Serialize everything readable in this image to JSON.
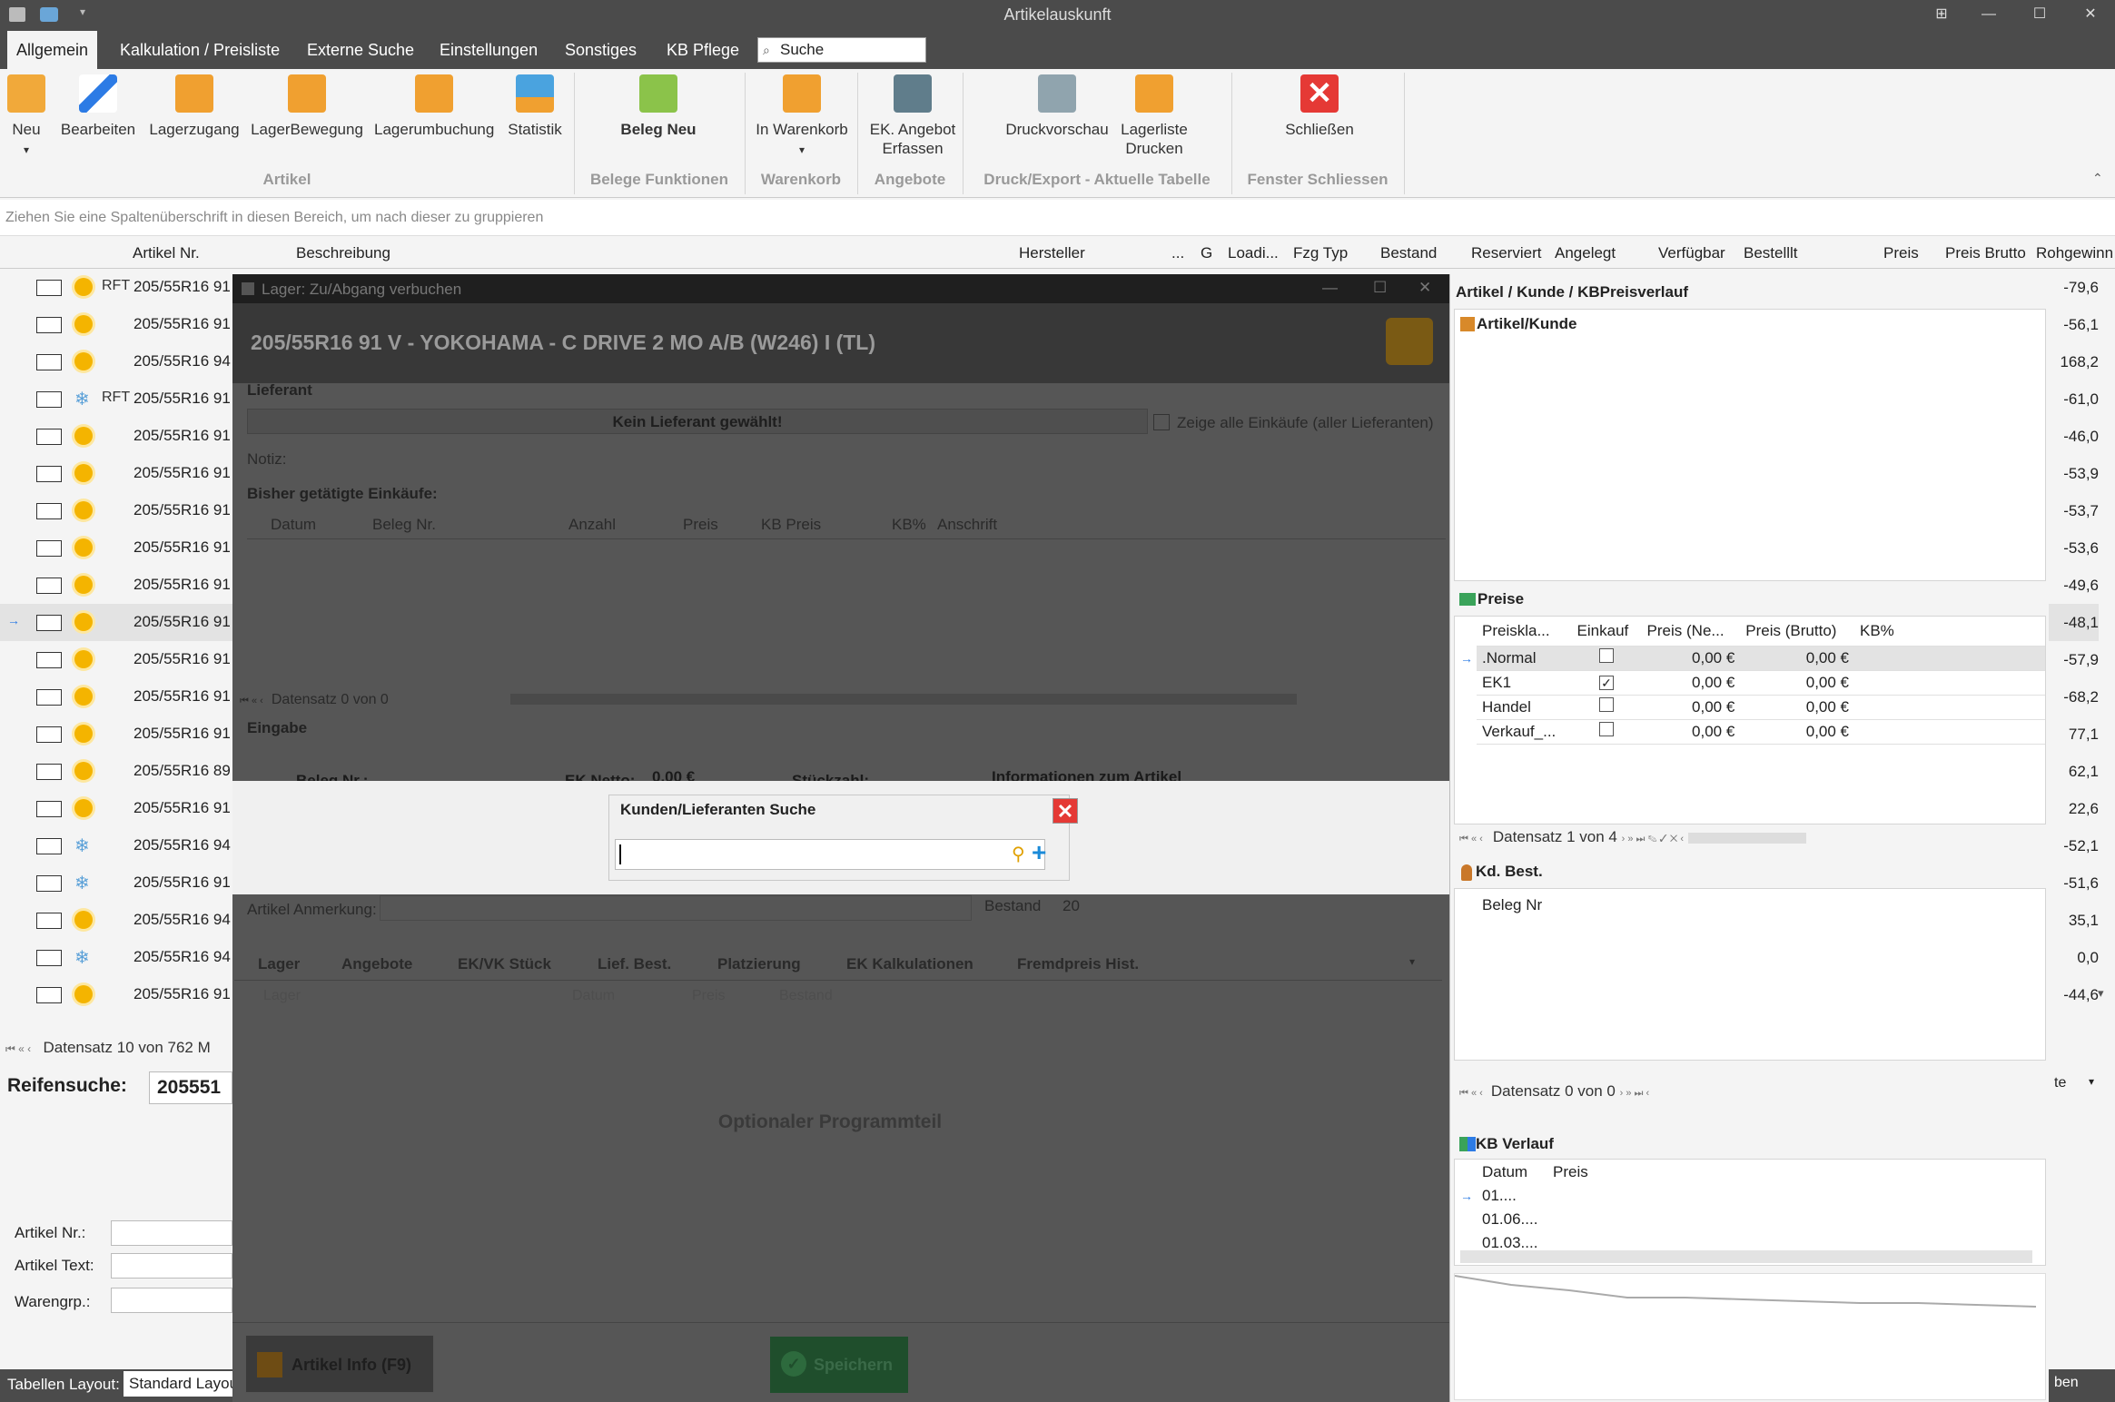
{
  "window": {
    "title": "Artikelauskunft"
  },
  "menu": {
    "tabs": [
      "Allgemein",
      "Kalkulation / Preisliste",
      "Externe Suche",
      "Einstellungen",
      "Sonstiges",
      "KB Pflege"
    ],
    "search_placeholder": "Suche"
  },
  "ribbon": {
    "buttons": {
      "neu": "Neu",
      "bearbeiten": "Bearbeiten",
      "lagerzugang": "Lagerzugang",
      "lagerbewegung": "LagerBewegung",
      "lagerumbuchung": "Lagerumbuchung",
      "statistik": "Statistik",
      "beleg_neu": "Beleg Neu",
      "in_warenkorb": "In Warenkorb",
      "ek_angebot_1": "EK. Angebot",
      "ek_angebot_2": "Erfassen",
      "druckvorschau": "Druckvorschau",
      "lagerliste_1": "Lagerliste",
      "lagerliste_2": "Drucken",
      "schliessen": "Schließen"
    },
    "groups": {
      "artikel": "Artikel",
      "belege": "Belege Funktionen",
      "warenkorb": "Warenkorb",
      "angebote": "Angebote",
      "druck": "Druck/Export - Aktuelle Tabelle",
      "fenster": "Fenster Schliessen"
    }
  },
  "grid": {
    "group_hint": "Ziehen Sie eine Spaltenüberschrift in diesen Bereich, um nach dieser zu gruppieren",
    "columns": {
      "artikel_nr": "Artikel Nr.",
      "beschreibung": "Beschreibung",
      "hersteller": "Hersteller",
      "dots": "...",
      "g": "G",
      "loadi": "Loadi...",
      "fzg_typ": "Fzg Typ",
      "bestand": "Bestand",
      "reserviert": "Reserviert",
      "angelegt": "Angelegt",
      "verfuegbar": "Verfügbar",
      "bestellt": "Bestelllt",
      "preis": "Preis",
      "preis_brutto": "Preis Brutto",
      "rohgewinn": "Rohgewinn"
    },
    "rows": [
      {
        "nr": "205/55R16 91",
        "icon": "sun",
        "rft": "RFT",
        "rg": "-79,6"
      },
      {
        "nr": "205/55R16 91",
        "icon": "sun",
        "rft": "",
        "rg": "-56,1"
      },
      {
        "nr": "205/55R16 94",
        "icon": "sun",
        "rft": "",
        "rg": "168,2"
      },
      {
        "nr": "205/55R16 91",
        "icon": "snow",
        "rft": "RFT",
        "rg": "-61,0"
      },
      {
        "nr": "205/55R16 91",
        "icon": "sun",
        "rft": "",
        "rg": "-46,0"
      },
      {
        "nr": "205/55R16 91",
        "icon": "sun",
        "rft": "",
        "rg": "-53,9"
      },
      {
        "nr": "205/55R16 91",
        "icon": "sun",
        "rft": "",
        "rg": "-53,7"
      },
      {
        "nr": "205/55R16 91",
        "icon": "sun",
        "rft": "",
        "rg": "-53,6"
      },
      {
        "nr": "205/55R16 91",
        "icon": "sun",
        "rft": "",
        "rg": "-49,6"
      },
      {
        "nr": "205/55R16 91",
        "icon": "sun",
        "rft": "",
        "rg": "-48,1"
      },
      {
        "nr": "205/55R16 91",
        "icon": "sun",
        "rft": "",
        "rg": "-57,9"
      },
      {
        "nr": "205/55R16 91",
        "icon": "sun",
        "rft": "",
        "rg": "-68,2"
      },
      {
        "nr": "205/55R16 91",
        "icon": "sun",
        "rft": "",
        "rg": "77,1"
      },
      {
        "nr": "205/55R16 89",
        "icon": "sun",
        "rft": "",
        "rg": "62,1"
      },
      {
        "nr": "205/55R16 91",
        "icon": "sun",
        "rft": "",
        "rg": "22,6"
      },
      {
        "nr": "205/55R16 94",
        "icon": "snow",
        "rft": "",
        "rg": "-52,1"
      },
      {
        "nr": "205/55R16 91",
        "icon": "snow",
        "rft": "",
        "rg": "-51,6"
      },
      {
        "nr": "205/55R16 94",
        "icon": "sun",
        "rft": "",
        "rg": "35,1"
      },
      {
        "nr": "205/55R16 94",
        "icon": "snow",
        "rft": "",
        "rg": "0,0"
      },
      {
        "nr": "205/55R16 91",
        "icon": "sun",
        "rft": "",
        "rg": "-44,6"
      }
    ],
    "nav": "Datensatz 10 von 762 M"
  },
  "left_bottom": {
    "reifensuche_label": "Reifensuche:",
    "reifensuche_value": "205551",
    "artikel_nr": "Artikel Nr.:",
    "artikel_text": "Artikel Text:",
    "warengrp": "Warengrp.:",
    "tabellen_layout": "Tabellen Layout:",
    "layout_value": "Standard Layou"
  },
  "dialog": {
    "title": "Lager: Zu/Abgang verbuchen",
    "heading": "205/55R16 91 V - YOKOHAMA - C DRIVE 2 MO A/B (W246) I (TL)",
    "lieferant": "Lieferant",
    "kein_lieferant": "Kein Lieferant gewählt!",
    "zeige_alle": "Zeige alle Einkäufe (aller Lieferanten)",
    "notiz": "Notiz:",
    "bisher": "Bisher getätigte Einkäufe:",
    "cols": [
      "Datum",
      "Beleg Nr.",
      "Anzahl",
      "Preis",
      "KB Preis",
      "KB%",
      "Anschrift"
    ],
    "nav": "Datensatz 0 von 0",
    "eingabe": "Eingabe",
    "beleg_nr": "Beleg Nr.:",
    "ek_netto": "EK Netto:",
    "ek_value": "0,00 €",
    "stueckzahl": "Stückzahl:",
    "info": "Informationen zum Artikel",
    "anmerkung": "Artikel Anmerkung:",
    "bestand": "Bestand",
    "bestand_value": "20",
    "tabs": [
      "Lager",
      "Angebote",
      "EK/VK Stück",
      "Lief. Best.",
      "Platzierung",
      "EK Kalkulationen",
      "Fremdpreis Hist."
    ],
    "tab_cols": [
      "Lager",
      "Datum",
      "Preis",
      "Bestand"
    ],
    "optional": "Optionaler Programmteil",
    "artikel_info": "Artikel Info (F9)",
    "speichern": "Speichern"
  },
  "search": {
    "title": "Kunden/Lieferanten Suche",
    "value": ""
  },
  "right": {
    "title": "Artikel / Kunde / KBPreisverlauf",
    "artikel_kunde": "Artikel/Kunde",
    "preise": "Preise",
    "preise_cols": [
      "Preiskla...",
      "Einkauf",
      "Preis (Ne...",
      "Preis (Brutto)",
      "KB%"
    ],
    "preise_rows": [
      {
        "name": ".Normal",
        "checked": false,
        "netto": "0,00 €",
        "brutto": "0,00 €"
      },
      {
        "name": "EK1",
        "checked": true,
        "netto": "0,00 €",
        "brutto": "0,00 €"
      },
      {
        "name": "Handel",
        "checked": false,
        "netto": "0,00 €",
        "brutto": "0,00 €"
      },
      {
        "name": "Verkauf_...",
        "checked": false,
        "netto": "0,00 €",
        "brutto": "0,00 €"
      }
    ],
    "preise_nav": "Datensatz 1 von 4",
    "kd_best": "Kd. Best.",
    "beleg_nr": "Beleg Nr",
    "kd_nav": "Datensatz 0 von 0",
    "kb_verlauf": "KB Verlauf",
    "kb_cols": [
      "Datum",
      "Preis"
    ],
    "kb_rows": [
      "01....",
      "01.06....",
      "01.03...."
    ],
    "side_te": "te",
    "side_ben": "ben"
  }
}
